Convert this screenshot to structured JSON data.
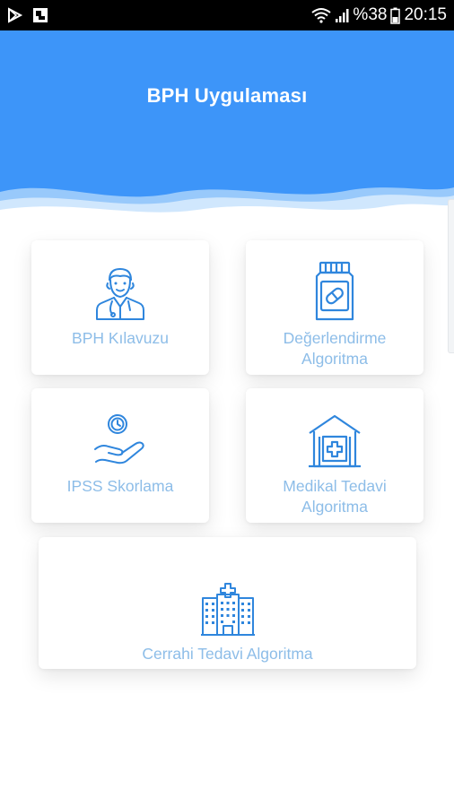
{
  "status_bar": {
    "battery": "%38",
    "time": "20:15",
    "icons": [
      "play-store-icon",
      "gallery-icon",
      "wifi-icon",
      "signal-icon",
      "battery-icon"
    ]
  },
  "header": {
    "title": "BPH Uygulaması",
    "color": "#3d95f9"
  },
  "cards": [
    {
      "label": "BPH Kılavuzu",
      "icon": "doctor-icon"
    },
    {
      "label": "Değerlendirme\nAlgoritma",
      "icon": "medicine-bottle-icon"
    },
    {
      "label": "IPSS Skorlama",
      "icon": "hand-clock-icon"
    },
    {
      "label": "Medikal Tedavi\nAlgoritma",
      "icon": "clinic-icon"
    },
    {
      "label": "Cerrahi Tedavi Algoritma",
      "icon": "hospital-icon"
    }
  ],
  "colors": {
    "icon": "#2f86dd",
    "label": "#8dbde8"
  }
}
